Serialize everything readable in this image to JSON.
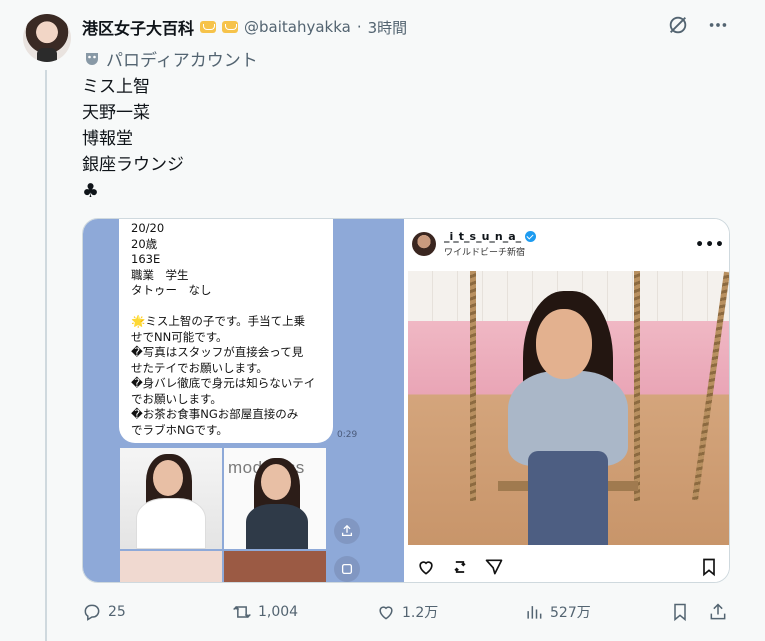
{
  "author": {
    "display_name": "港区女子大百科",
    "handle": "@baitahyakka",
    "separator": "·",
    "time": "3時間",
    "label": "パロディアカウント"
  },
  "tweet": {
    "lines": [
      "ミス上智",
      "天野一菜",
      "博報堂",
      "銀座ラウンジ",
      "♣"
    ]
  },
  "chat_screenshot": {
    "lines": [
      "20/20",
      "20歳",
      "163E",
      "職業　学生",
      "タトゥー　なし",
      "",
      "🌟ミス上智の子です。手当て上乗",
      "せでNN可能です。",
      "�写真はスタッフが直接会って見",
      "せたテイでお願いします。",
      "�身バレ徹底で身元は知らないテイ",
      "でお願いします。",
      "�お茶お食事NGお部屋直接のみ",
      "でラブホNGです。"
    ],
    "time": "0:29",
    "thumb_text": "modeless"
  },
  "instagram_post": {
    "username": "_i_t_s_u_n_a_",
    "location": "ワイルドビーチ新宿",
    "more": "•••"
  },
  "stats": {
    "replies": "25",
    "retweets": "1,004",
    "likes": "1.2万",
    "views": "527万"
  },
  "colors": {
    "chat_bg": "#8ea9d8",
    "verified": "#1d9bf0",
    "muted_text": "#536471"
  }
}
